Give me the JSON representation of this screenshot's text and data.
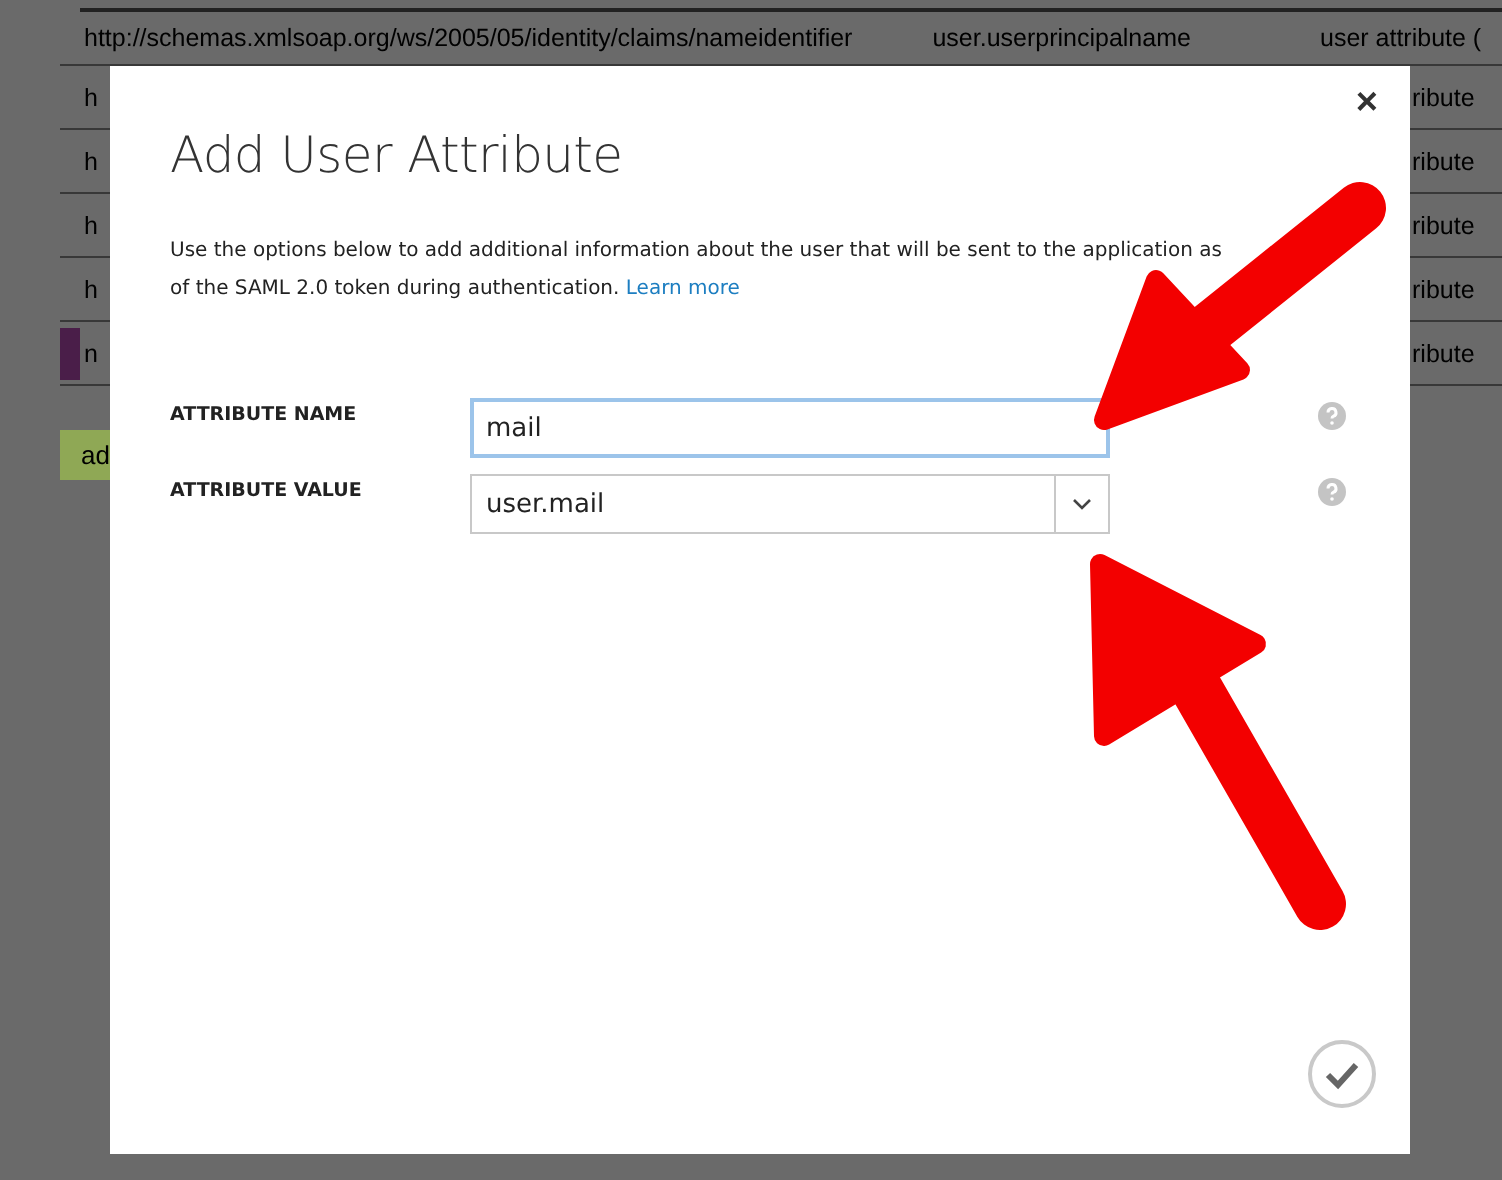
{
  "background_table": {
    "rows": [
      {
        "column_1": "http://schemas.xmlsoap.org/ws/2005/05/identity/claims/nameidentifier",
        "column_2": "user.userprincipalname",
        "column_3": "user attribute ("
      },
      {
        "column_1": "h",
        "column_3": "ribute"
      },
      {
        "column_1": "h",
        "column_3": "ribute"
      },
      {
        "column_1": "h",
        "column_3": "ribute"
      },
      {
        "column_1": "h",
        "column_3": "ribute"
      },
      {
        "column_1": "n",
        "column_3": "ribute",
        "marked": true
      }
    ],
    "add_button": "ad"
  },
  "dialog": {
    "title": "Add User Attribute",
    "close": "×",
    "description": {
      "lines": [
        "Use the options below to add additional information about the user that will be sent to the application as",
        "of the SAML 2.0 token during authentication."
      ],
      "link": "Learn more"
    },
    "fields": [
      {
        "kind": "text",
        "label": "ATTRIBUTE NAME",
        "value": "mail",
        "focused": true
      },
      {
        "kind": "dropdown",
        "label": "ATTRIBUTE VALUE",
        "value": "user.mail",
        "focused": false
      }
    ]
  },
  "annotations": [
    {
      "kind": "arrow"
    },
    {
      "kind": "arrow"
    }
  ]
}
